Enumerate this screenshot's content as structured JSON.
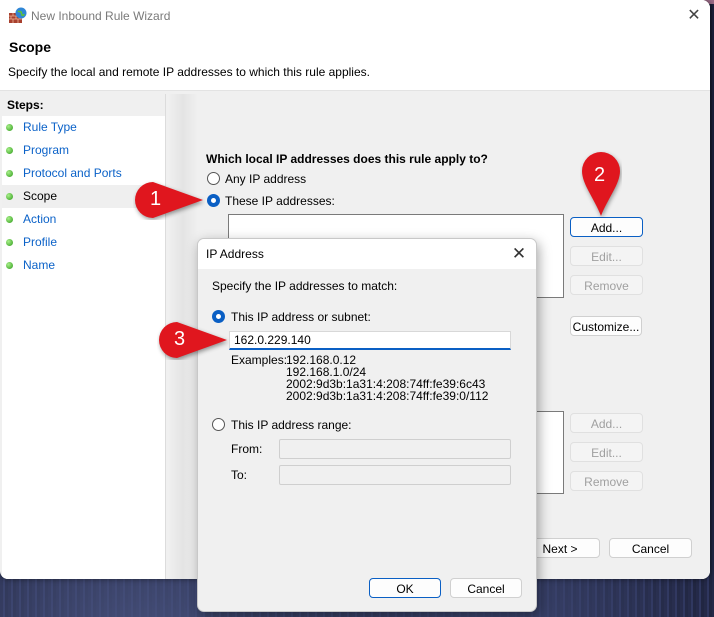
{
  "window": {
    "title": "New Inbound Rule Wizard",
    "close_glyph": "✕",
    "header_title": "Scope",
    "header_subtitle": "Specify the local and remote IP addresses to which this rule applies."
  },
  "steps": {
    "heading": "Steps:",
    "items": [
      {
        "label": "Rule Type",
        "active": false
      },
      {
        "label": "Program",
        "active": false
      },
      {
        "label": "Protocol and Ports",
        "active": false
      },
      {
        "label": "Scope",
        "active": true
      },
      {
        "label": "Action",
        "active": false
      },
      {
        "label": "Profile",
        "active": false
      },
      {
        "label": "Name",
        "active": false
      }
    ]
  },
  "scope": {
    "local_question": "Which local IP addresses does this rule apply to?",
    "local_any": "Any IP address",
    "local_these": "These IP addresses:",
    "local_selected": "these",
    "local_buttons": {
      "add": "Add...",
      "edit": "Edit...",
      "remove": "Remove"
    },
    "customize": "Customize...",
    "remote_buttons": {
      "add": "Add...",
      "edit": "Edit...",
      "remove": "Remove"
    }
  },
  "footer": {
    "next": "Next >",
    "cancel": "Cancel"
  },
  "ip_dialog": {
    "title": "IP Address",
    "close_glyph": "✕",
    "instruction": "Specify the IP addresses to match:",
    "option_subnet": "This IP address or subnet:",
    "subnet_value": "162.0.229.140",
    "examples_label": "Examples:",
    "examples": [
      "192.168.0.12",
      "192.168.1.0/24",
      "2002:9d3b:1a31:4:208:74ff:fe39:6c43",
      "2002:9d3b:1a31:4:208:74ff:fe39:0/112"
    ],
    "option_range": "This IP address range:",
    "from_label": "From:",
    "to_label": "To:",
    "from_value": "",
    "to_value": "",
    "selected": "subnet",
    "ok": "OK",
    "cancel": "Cancel"
  },
  "annotations": [
    {
      "number": "1"
    },
    {
      "number": "2"
    },
    {
      "number": "3"
    }
  ],
  "colors": {
    "accent": "#0a5fc4",
    "marker": "#e0161e",
    "link": "#0b62c8"
  }
}
